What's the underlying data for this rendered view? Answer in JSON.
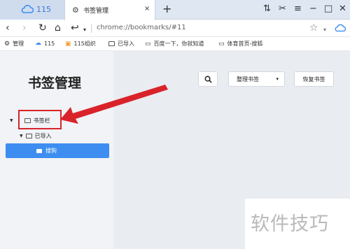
{
  "tabs": {
    "home_label": "115",
    "active_title": "书签管理",
    "close_glyph": "×",
    "new_tab_glyph": "+"
  },
  "window_controls": [
    "⇅",
    "✂",
    "≡",
    "−",
    "□",
    "✕"
  ],
  "address": {
    "url": "chrome://bookmarks/#11"
  },
  "bookmarks_bar": [
    {
      "label": "管理",
      "icon": "gear-icon"
    },
    {
      "label": "115",
      "icon": "115-icon"
    },
    {
      "label": "115组织",
      "icon": "115-org-icon"
    },
    {
      "label": "已导入",
      "icon": "folder-icon"
    },
    {
      "label": "百度一下，你就知道",
      "icon": "page-icon"
    },
    {
      "label": "体育首页-搜狐",
      "icon": "page-icon"
    }
  ],
  "sidebar": {
    "title": "书签管理",
    "tree": {
      "root_label": "书签栏",
      "child_label": "已导入",
      "selected_label": "搜狗"
    }
  },
  "toolbar": {
    "organize_label": "整理书签",
    "restore_label": "恢复书签"
  },
  "colors": {
    "accent": "#3d8ef0",
    "highlight_red": "#d9232b"
  },
  "watermark": "软件技巧"
}
